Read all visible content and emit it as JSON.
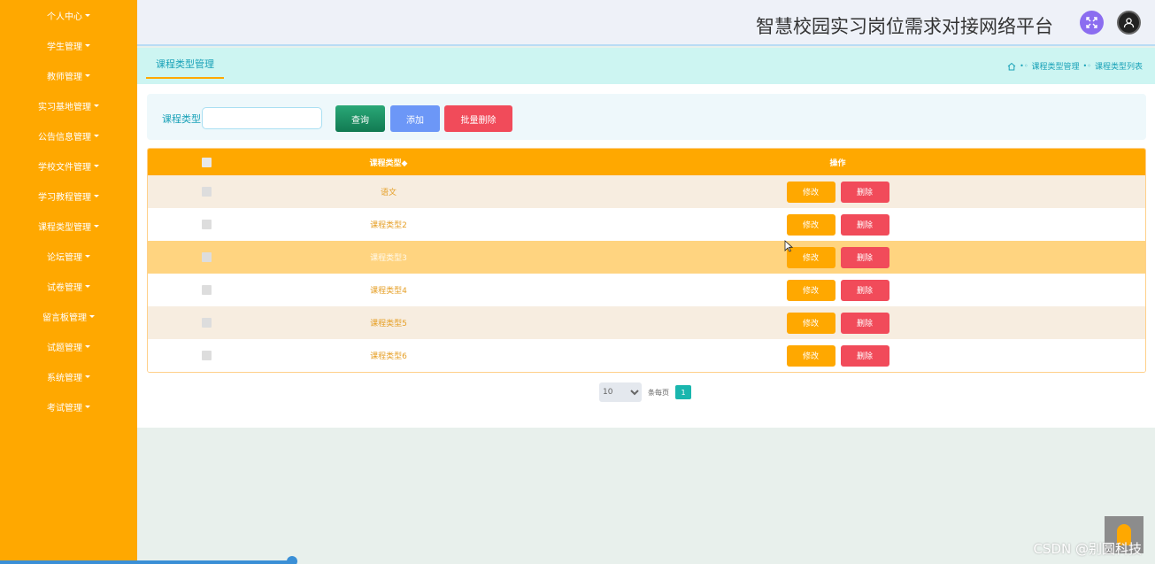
{
  "sidebar": {
    "items": [
      {
        "label": "个人中心"
      },
      {
        "label": "学生管理"
      },
      {
        "label": "教师管理"
      },
      {
        "label": "实习基地管理"
      },
      {
        "label": "公告信息管理"
      },
      {
        "label": "学校文件管理"
      },
      {
        "label": "学习教程管理"
      },
      {
        "label": "课程类型管理"
      },
      {
        "label": "论坛管理"
      },
      {
        "label": "试卷管理"
      },
      {
        "label": "留言板管理"
      },
      {
        "label": "试题管理"
      },
      {
        "label": "系统管理"
      },
      {
        "label": "考试管理"
      }
    ]
  },
  "header": {
    "title": "智慧校园实习岗位需求对接网络平台",
    "expand_icon": "expand-icon",
    "user_icon": "user-icon"
  },
  "breadcrumb": {
    "tab": "课程类型管理",
    "items": [
      "课程类型管理",
      "课程类型列表"
    ]
  },
  "search": {
    "label": "课程类型",
    "value": "",
    "query_label": "查询",
    "add_label": "添加",
    "batch_delete_label": "批量删除"
  },
  "table": {
    "headers": {
      "name": "课程类型◆",
      "ops": "操作"
    },
    "rows": [
      {
        "name": "语文"
      },
      {
        "name": "课程类型2"
      },
      {
        "name": "课程类型3"
      },
      {
        "name": "课程类型4"
      },
      {
        "name": "课程类型5"
      },
      {
        "name": "课程类型6"
      }
    ],
    "edit_label": "修改",
    "delete_label": "删除"
  },
  "pager": {
    "page_size": "10",
    "per_page_label": "条每页",
    "current_page": "1"
  },
  "watermark": "CSDN @别圆科技",
  "colors": {
    "sidebar": "#ffa800",
    "accent": "#1aa2b8",
    "danger": "#f14b5a",
    "primary": "#6c97f7"
  }
}
